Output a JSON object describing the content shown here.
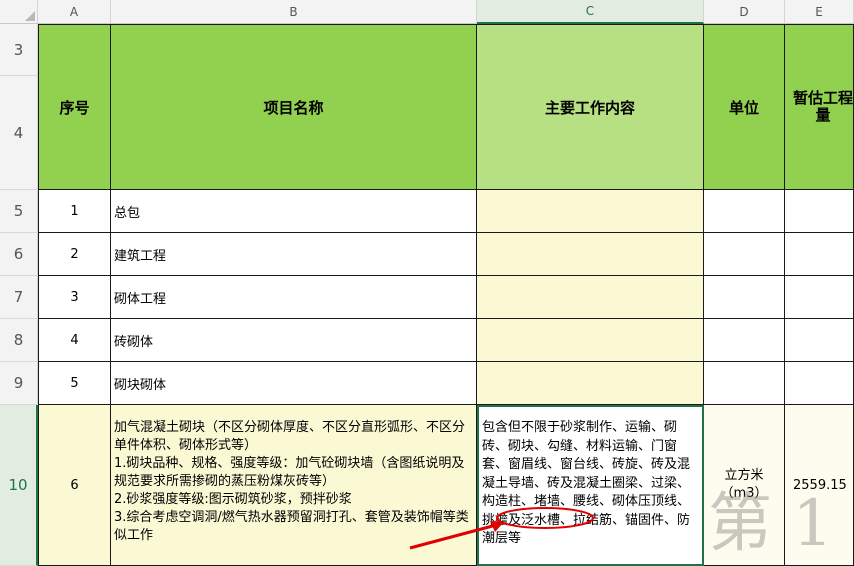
{
  "columns": [
    "A",
    "B",
    "C",
    "D",
    "E"
  ],
  "selected_column": "C",
  "row_numbers": [
    "3",
    "4",
    "5",
    "6",
    "7",
    "8",
    "9",
    "10"
  ],
  "selected_row": "10",
  "header": {
    "seq": "序号",
    "name": "项目名称",
    "work": "主要工作内容",
    "unit": "单位",
    "qty": "暂估工程量"
  },
  "rows": [
    {
      "seq": "1",
      "name": "总包"
    },
    {
      "seq": "2",
      "name": "建筑工程"
    },
    {
      "seq": "3",
      "name": "砌体工程"
    },
    {
      "seq": "4",
      "name": "砖砌体"
    },
    {
      "seq": "5",
      "name": "砌块砌体"
    }
  ],
  "row10": {
    "seq": "6",
    "name": "加气混凝土砌块（不区分砌体厚度、不区分直形弧形、不区分单件体积、砌体形式等）\n1.砌块品种、规格、强度等级：加气砼砌块墙（含图纸说明及规范要求所需掺砌的蒸压粉煤灰砖等）\n2.砂浆强度等级:图示砌筑砂浆，预拌砂浆\n3.综合考虑空调洞/燃气热水器预留洞打孔、套管及装饰帽等类似工作",
    "work": "包含但不限于砂浆制作、运输、砌砖、砌块、勾缝、材料运输、门窗套、窗眉线、窗台线、砖旋、砖及混凝土导墙、砖及混凝土圈梁、过梁、构造柱、堵墙、腰线、砌体压顶线、挑檐及泛水槽、拉结筋、锚固件、防潮层等",
    "unit": "立方米（m3）",
    "qty": "2559.15"
  },
  "highlight_text": "砌体压顶线",
  "watermark": "第 1",
  "colors": {
    "header_green": "#92d050",
    "selected_header_green": "#b6e081",
    "yellow_fill": "#fbf9d4",
    "selection_border": "#217346",
    "annotation_red": "#e00000"
  }
}
